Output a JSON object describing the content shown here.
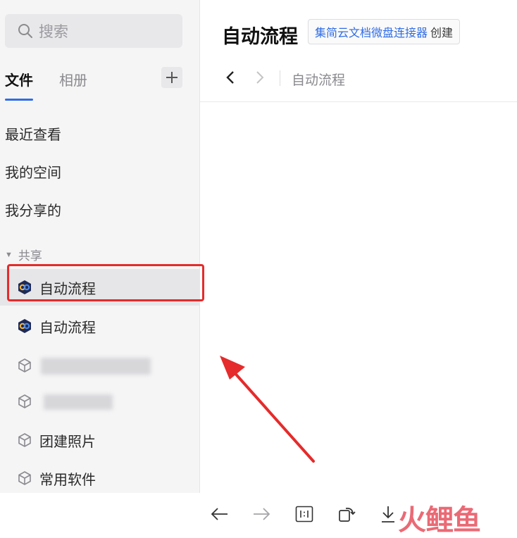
{
  "sidebar": {
    "search_placeholder": "搜索",
    "tabs": [
      {
        "label": "文件",
        "active": true
      },
      {
        "label": "相册",
        "active": false
      }
    ],
    "nav": [
      {
        "label": "最近查看"
      },
      {
        "label": "我的空间"
      },
      {
        "label": "我分享的"
      }
    ],
    "section_title": "共享",
    "shared_items": [
      {
        "label": "自动流程",
        "icon": "workflow-icon",
        "selected": true
      },
      {
        "label": "自动流程",
        "icon": "workflow-icon",
        "selected": false
      },
      {
        "label": "",
        "icon": "cube-icon",
        "redacted": true
      },
      {
        "label": "",
        "icon": "cube-icon",
        "redacted": true
      },
      {
        "label": "团建照片",
        "icon": "cube-icon"
      },
      {
        "label": "常用软件",
        "icon": "cube-icon"
      }
    ]
  },
  "main": {
    "title": "自动流程",
    "badge_link": "集简云文档微盘连接器",
    "badge_suffix": "创建",
    "breadcrumb": "自动流程"
  },
  "watermark": {
    "text": "火鲤鱼"
  },
  "colors": {
    "accent": "#2f6ce5",
    "highlight": "#e52b2b",
    "arrow": "#e52b2b",
    "watermark": "#e85a67"
  }
}
